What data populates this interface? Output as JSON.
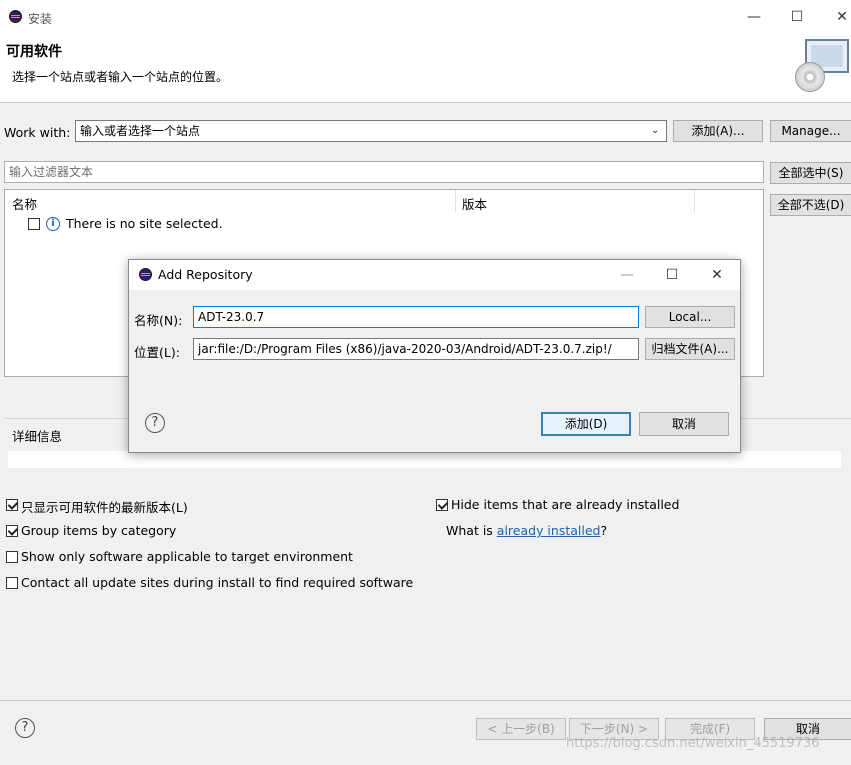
{
  "window": {
    "title": "安装",
    "page_title": "可用软件",
    "page_subtitle": "选择一个站点或者输入一个站点的位置。",
    "min_glyph": "—",
    "max_glyph": "☐",
    "close_glyph": "✕"
  },
  "work_with": {
    "label": "Work with:",
    "placeholder": "输入或者选择一个站点",
    "add_button": "添加(A)...",
    "manage_button": "Manage..."
  },
  "filter": {
    "placeholder": "输入过滤器文本",
    "select_all": "全部选中(S)",
    "deselect_all": "全部不选(D)"
  },
  "table": {
    "columns": [
      "名称",
      "版本"
    ],
    "rows": [
      {
        "text": "There is no site selected.",
        "icon": "info-icon"
      }
    ]
  },
  "details": {
    "label": "详细信息"
  },
  "options": {
    "left": [
      {
        "label": "只显示可用软件的最新版本(L)",
        "checked": true
      },
      {
        "label": "Group items by category",
        "checked": true
      },
      {
        "label": "Show only software applicable to target environment",
        "checked": false
      },
      {
        "label": "Contact all update sites during install to find required software",
        "checked": false
      }
    ],
    "hide_installed": {
      "label": "Hide items that are already installed",
      "checked": true
    },
    "what_is_prefix": "What is ",
    "what_is_link": "already installed",
    "what_is_suffix": "?"
  },
  "footer": {
    "back": "< 上一步(B)",
    "next": "下一步(N) >",
    "finish": "完成(F)",
    "cancel": "取消",
    "watermark": "https://blog.csdn.net/weixin_45519736"
  },
  "dialog": {
    "title": "Add Repository",
    "name_label": "名称(N):",
    "name_value": "ADT-23.0.7",
    "location_label": "位置(L):",
    "location_value": "jar:file:/D:/Program Files (x86)/java-2020-03/Android/ADT-23.0.7.zip!/",
    "local_button": "Local...",
    "archive_button": "归档文件(A)...",
    "ok_button": "添加(D)",
    "cancel_button": "取消"
  }
}
